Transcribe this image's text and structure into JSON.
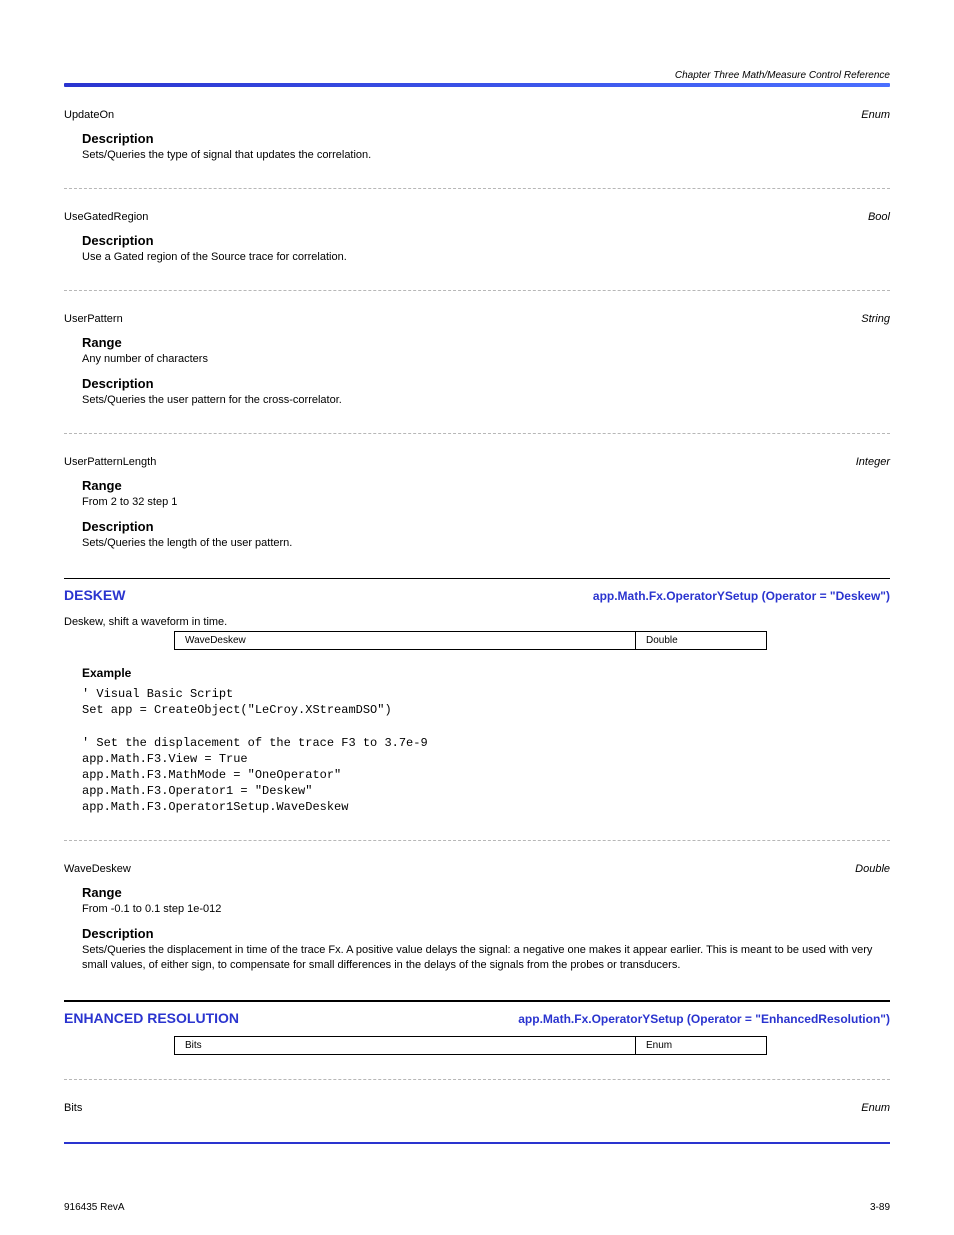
{
  "header": {
    "page_title": "Chapter Three Math/Measure Control Reference"
  },
  "items": [
    {
      "divider": "blue",
      "name": "UpdateOn",
      "type": "Enum",
      "label": "Description",
      "desc": "Sets/Queries the type of signal that updates the correlation.",
      "sep_after": "dash"
    },
    {
      "name": "UseGatedRegion",
      "type": "Bool",
      "label": "Description",
      "desc": "Use a Gated region of the Source trace for correlation.",
      "sep_after": "dash"
    },
    {
      "name": "UserPattern",
      "type": "String",
      "range_label": "Range",
      "range": "Any number of characters",
      "label": "Description",
      "desc": "Sets/Queries the user pattern for the cross-correlator.",
      "sep_after": "dash"
    },
    {
      "name": "UserPatternLength",
      "type": "Integer",
      "range_label": "Range",
      "range": "From 2 to 32 step 1",
      "label": "Description",
      "desc": "Sets/Queries the length of the user pattern."
    }
  ],
  "deskew": {
    "heading_text": "DESKEW",
    "path": "app.Math.Fx.OperatorYSetup (Operator = \"Deskew\")",
    "blurb": "Deskew, shift a waveform in time.",
    "table": [
      {
        "col1": "WaveDeskew",
        "col2": "Double"
      }
    ],
    "example_label": "Example",
    "code": "' Visual Basic Script\nSet app = CreateObject(\"LeCroy.XStreamDSO\")\n\n' Set the displacement of the trace F3 to 3.7e-9\napp.Math.F3.View = True\napp.Math.F3.MathMode = \"OneOperator\"\napp.Math.F3.Operator1 = \"Deskew\"\napp.Math.F3.Operator1Setup.WaveDeskew",
    "item": {
      "name": "WaveDeskew",
      "type": "Double",
      "range_label": "Range",
      "range": "From -0.1 to 0.1 step 1e-012",
      "label": "Description",
      "desc": "Sets/Queries the displacement in time of the trace Fx. A positive value delays the signal: a negative one makes it appear earlier. This is meant to be used with very small values, of either sign, to compensate for small differences in the delays of the signals from the probes or transducers."
    }
  },
  "enhres": {
    "heading_text": "ENHANCED RESOLUTION",
    "path": "app.Math.Fx.OperatorYSetup (Operator = \"EnhancedResolution\")",
    "table": [
      {
        "col1": "Bits",
        "col2": "Enum"
      }
    ],
    "item": {
      "name": "Bits",
      "type": "Enum"
    }
  },
  "footer": {
    "doc": "916435 RevA",
    "page": "3-89"
  }
}
